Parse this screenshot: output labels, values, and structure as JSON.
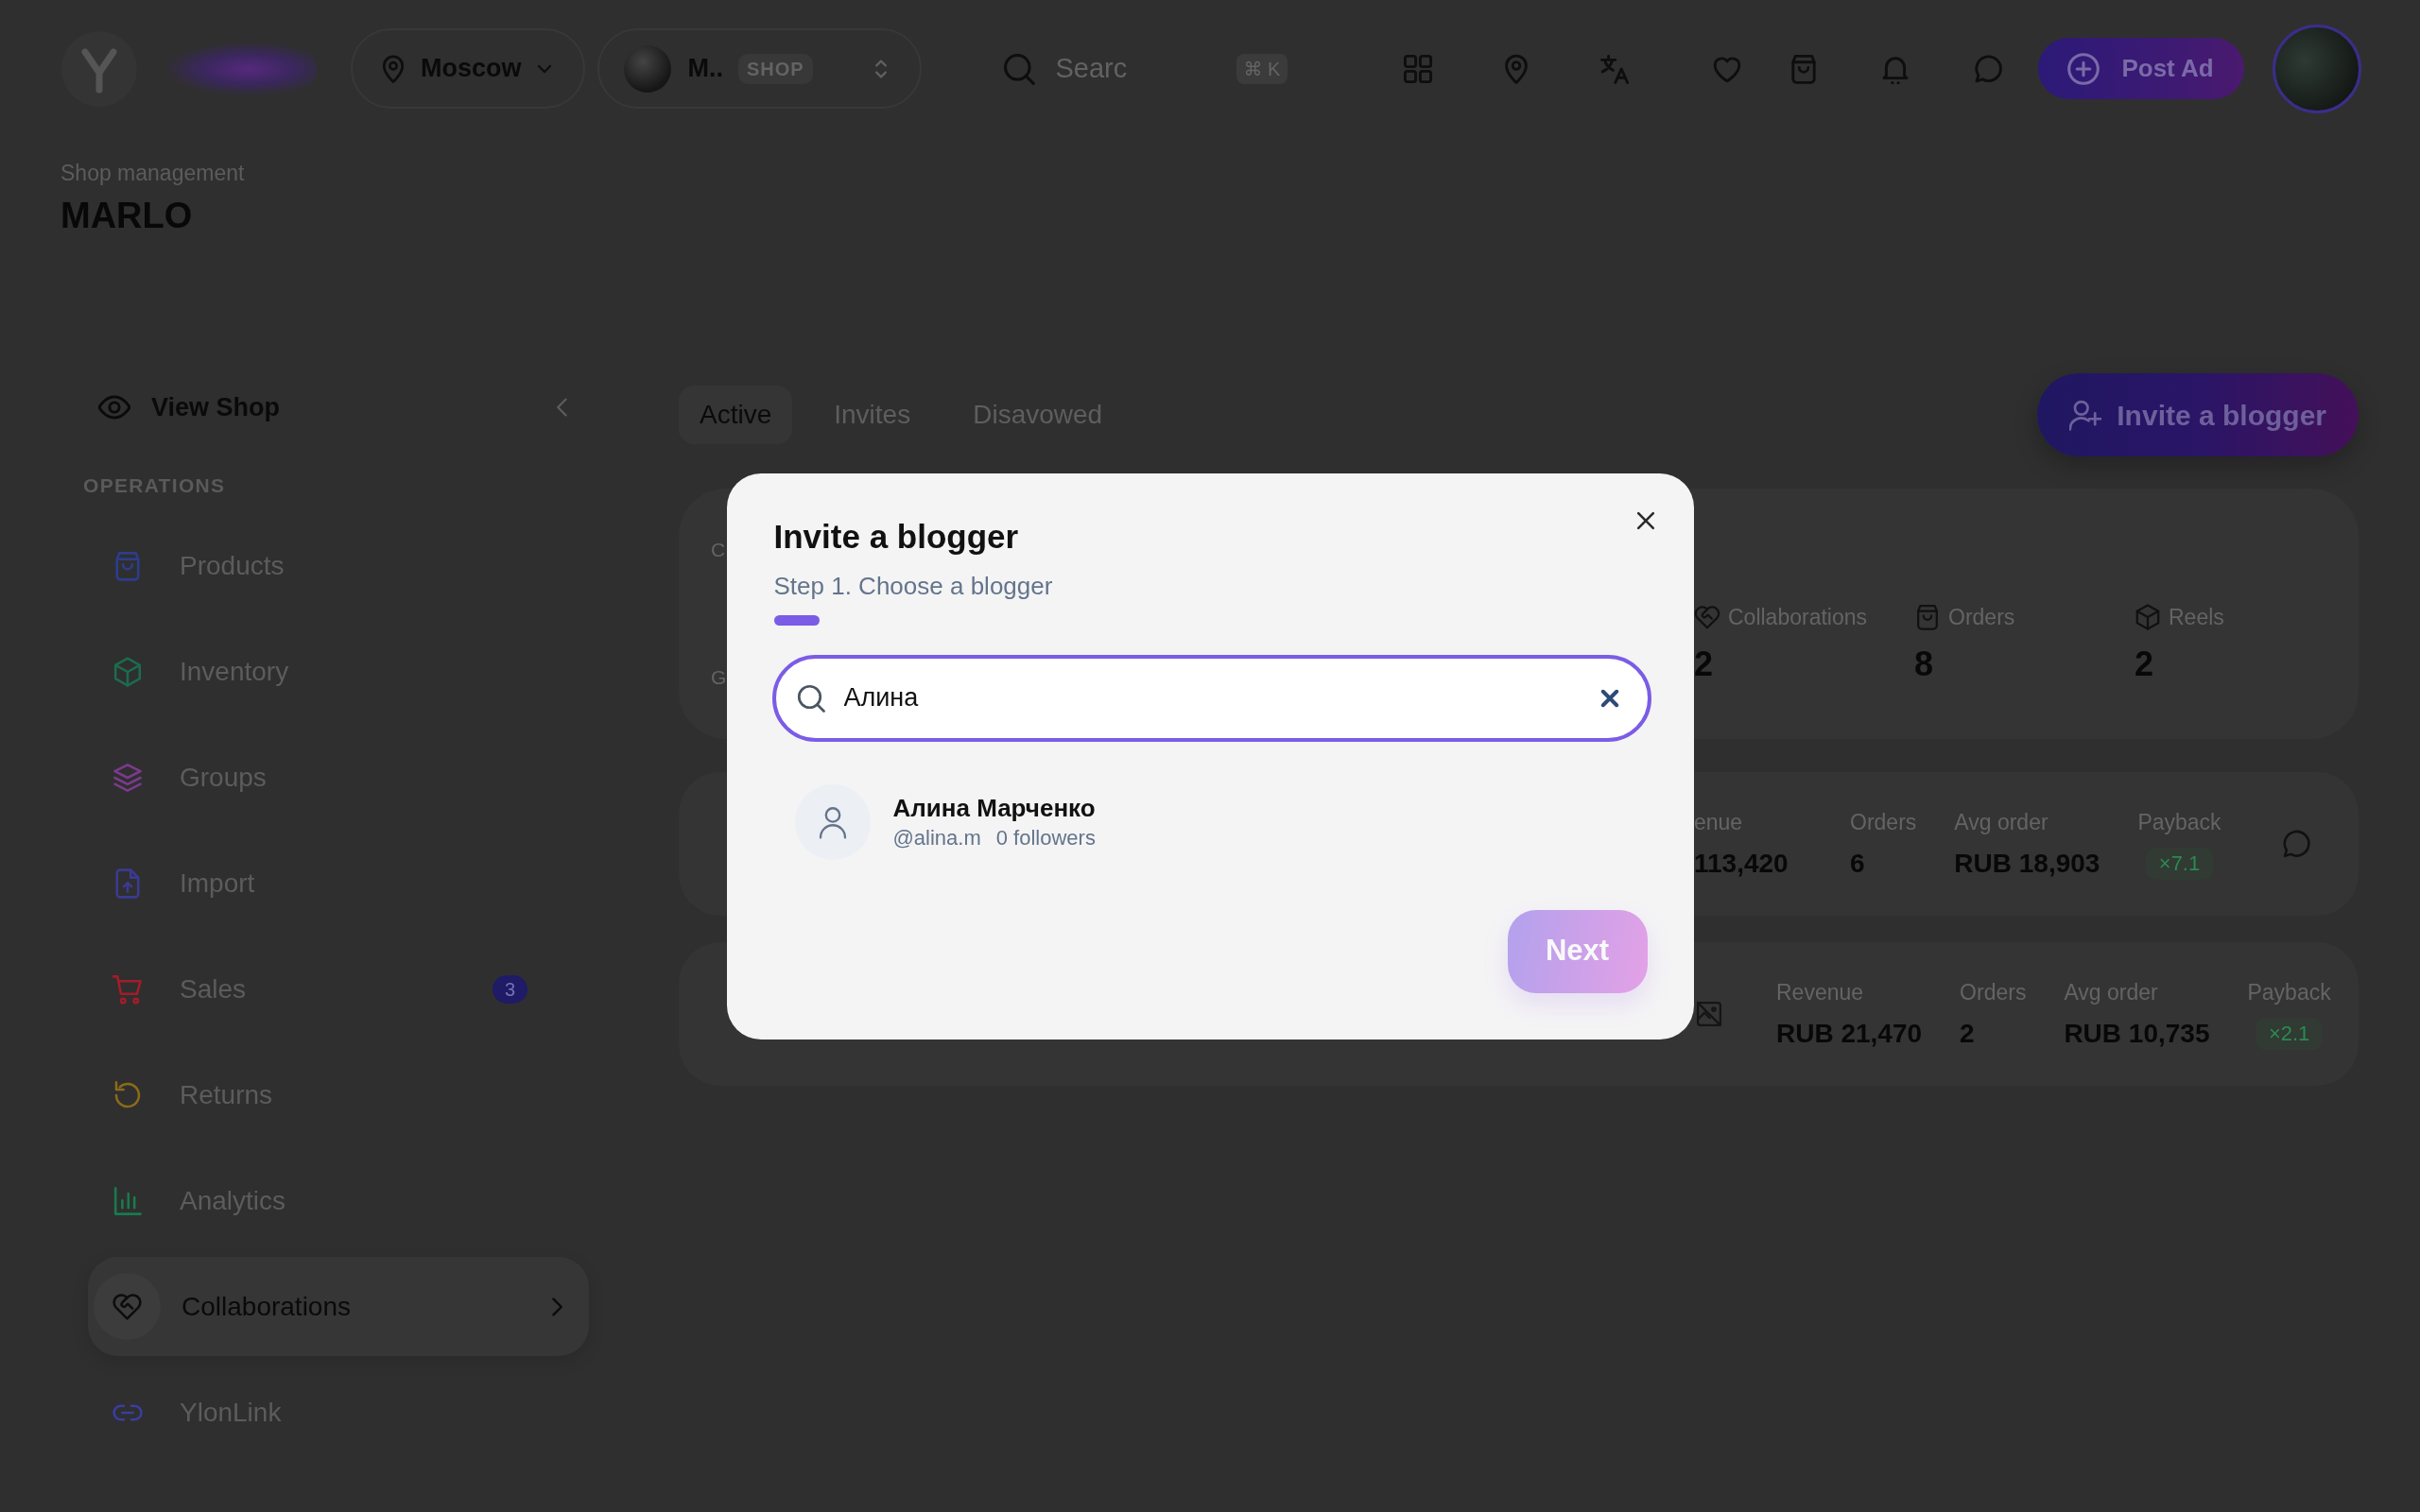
{
  "top_bar": {
    "location": "Moscow",
    "shop": {
      "name": "M..",
      "tag": "SHOP"
    },
    "search": {
      "placeholder": "Searc",
      "shortcut": "⌘ K"
    },
    "post_ad_button": "Post Ad"
  },
  "page_header": {
    "section": "Shop management",
    "title": "MARLO"
  },
  "sidebar": {
    "view_shop": "View Shop",
    "section_title": "OPERATIONS",
    "items": [
      {
        "label": "Products",
        "color": "#2c3d8f",
        "selected": false
      },
      {
        "label": "Inventory",
        "color": "#1c6b4f",
        "selected": false
      },
      {
        "label": "Groups",
        "color": "#7b3a8e",
        "selected": false
      },
      {
        "label": "Import",
        "color": "#3b3a94",
        "selected": false
      },
      {
        "label": "Sales",
        "color": "#a31c2a",
        "badge": "3",
        "selected": false
      },
      {
        "label": "Returns",
        "color": "#8b6a1a",
        "selected": false
      },
      {
        "label": "Analytics",
        "color": "#1a7a4e",
        "selected": false
      },
      {
        "label": "Collaborations",
        "color": "#0d0d0d",
        "selected": true
      },
      {
        "label": "YlonLink",
        "color": "#3b3da0",
        "selected": false
      }
    ]
  },
  "tabs": [
    {
      "label": "Active",
      "selected": true
    },
    {
      "label": "Invites",
      "selected": false
    },
    {
      "label": "Disavowed",
      "selected": false
    }
  ],
  "invite_button": "Invite a blogger",
  "summary_card": {
    "cut_text_1": "C",
    "cut_text_2": "G",
    "stats": [
      {
        "label": "Collaborations",
        "value": "2"
      },
      {
        "label": "Orders",
        "value": "8"
      },
      {
        "label": "Reels",
        "value": "2"
      }
    ]
  },
  "collaboration_rows": [
    {
      "image_missing": false,
      "chat_button": true,
      "metrics": [
        {
          "kind": "text",
          "label": "enue",
          "value": "113,420"
        },
        {
          "kind": "text",
          "label": "Orders",
          "value": "6"
        },
        {
          "kind": "text",
          "label": "Avg order",
          "value": "RUB 18,903"
        },
        {
          "kind": "badge",
          "label": "Payback",
          "value": "×7.1"
        }
      ]
    },
    {
      "image_missing": true,
      "chat_button": false,
      "metrics": [
        {
          "kind": "text",
          "label": "Revenue",
          "value": "RUB 21,470"
        },
        {
          "kind": "text",
          "label": "Orders",
          "value": "2"
        },
        {
          "kind": "text",
          "label": "Avg order",
          "value": "RUB 10,735"
        },
        {
          "kind": "badge",
          "label": "Payback",
          "value": "×2.1"
        }
      ]
    }
  ],
  "modal": {
    "title": "Invite a blogger",
    "subtitle": "Step 1. Choose a blogger",
    "search": {
      "value": "Алина"
    },
    "results": [
      {
        "name": "Алина Марченко",
        "handle": "@alina.m",
        "followers": "0 followers",
        "selected": false
      }
    ],
    "next_button": {
      "label": "Next",
      "disabled": true
    }
  }
}
